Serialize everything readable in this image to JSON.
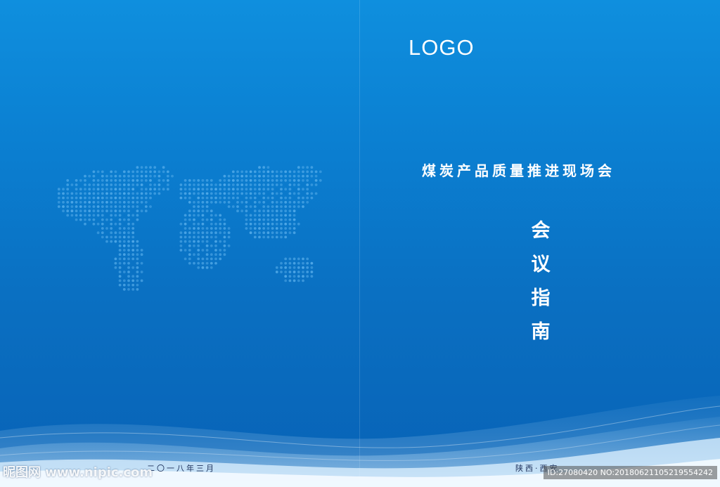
{
  "cover": {
    "logo": "LOGO",
    "event_title": "煤炭产品质量推进现场会",
    "doc_title_chars": [
      "会",
      "议",
      "指",
      "南"
    ],
    "date": "二〇一八年三月",
    "location": "陕西·西安"
  },
  "watermark": {
    "site": "昵图网 www.nipic.com",
    "id_text": "ID:27080420 NO:20180621105219554242"
  },
  "colors": {
    "background_top": "#0f8fde",
    "background_bottom": "#0862b6",
    "map_dots": "#5fb3ee"
  },
  "icons": {
    "map": "world-map-dots-icon"
  }
}
